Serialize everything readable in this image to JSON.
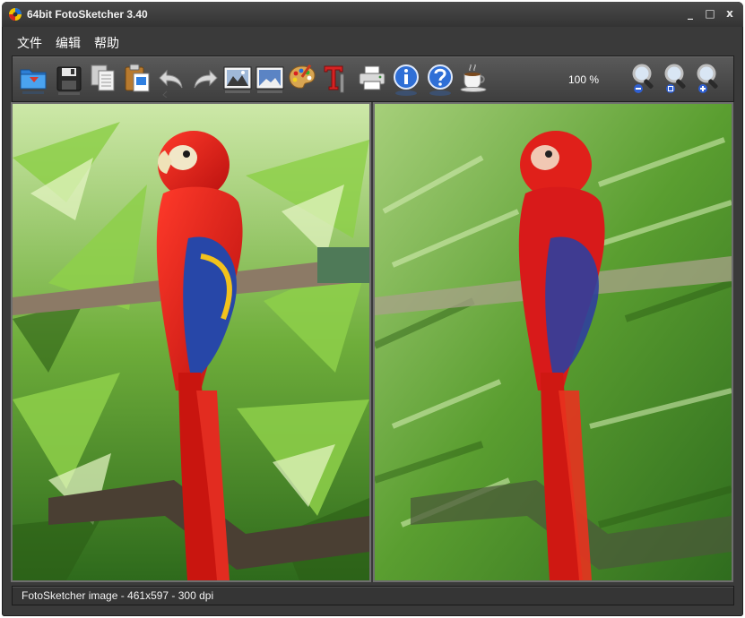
{
  "window": {
    "title": "64bit FotoSketcher 3.40",
    "controls": {
      "minimize": "_",
      "maximize": "□",
      "close": "x"
    }
  },
  "menu": {
    "items": [
      {
        "label": "文件"
      },
      {
        "label": "编辑"
      },
      {
        "label": "帮助"
      }
    ]
  },
  "toolbar": {
    "buttons": [
      {
        "icon": "open-folder-icon"
      },
      {
        "icon": "save-disk-icon"
      },
      {
        "icon": "copy-icon"
      },
      {
        "icon": "paste-clipboard-icon"
      },
      {
        "icon": "undo-arrow-icon"
      },
      {
        "icon": "redo-arrow-icon"
      },
      {
        "icon": "source-image-icon"
      },
      {
        "icon": "result-image-icon"
      },
      {
        "icon": "palette-icon"
      },
      {
        "icon": "text-tool-icon"
      },
      {
        "icon": "printer-icon"
      },
      {
        "icon": "info-icon"
      },
      {
        "icon": "help-icon"
      },
      {
        "icon": "coffee-cup-icon"
      }
    ],
    "zoom_level": "100 %",
    "zoom_buttons": [
      {
        "icon": "zoom-out-icon"
      },
      {
        "icon": "zoom-fit-icon"
      },
      {
        "icon": "zoom-in-icon"
      }
    ]
  },
  "colors": {
    "window_bg": "#3a3a3a",
    "toolbar_bg": "#4a4a4a",
    "panel_border": "#6e6e6e",
    "text": "#ffffff",
    "parrot_red": "#d81a1a",
    "parrot_blue": "#2747a8",
    "foliage_green": "#4e9a2a"
  },
  "status": {
    "text": "FotoSketcher image - 461x597 - 300 dpi"
  }
}
